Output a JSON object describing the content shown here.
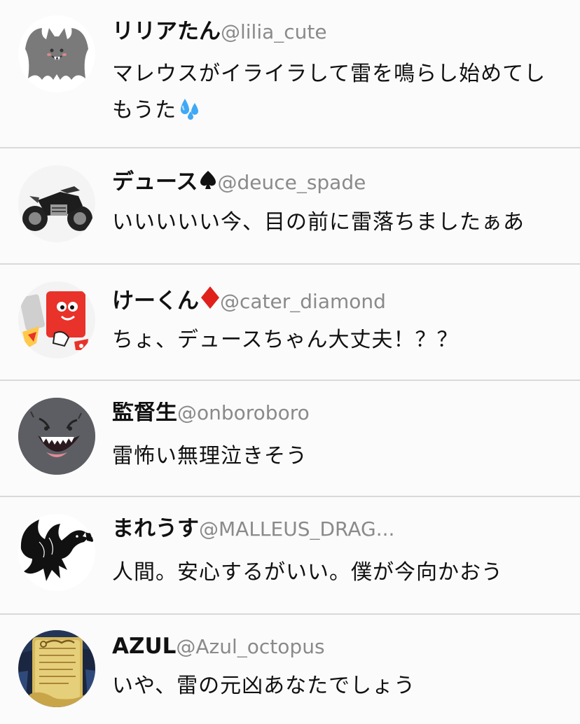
{
  "tweets": [
    {
      "display_name": "リリアたん",
      "handle": "@lilia_cute",
      "text": "マレウスがイライラして雷を鳴らし始めてしもうた",
      "avatar_icon": "bat-icon",
      "trailing_emoji": "sweat-droplets-emoji"
    },
    {
      "display_name": "デュース",
      "handle": "@deuce_spade",
      "text": "いいいいい今、目の前に雷落ちましたぁあ",
      "avatar_icon": "motorcycle-icon",
      "suit_icon": "spade-icon"
    },
    {
      "display_name": "けーくん",
      "handle": "@cater_diamond",
      "text": "ちょ、デュースちゃん大丈夫！？？",
      "avatar_icon": "red-phone-character-icon",
      "suit_icon": "diamond-icon"
    },
    {
      "display_name": "監督生",
      "handle": "@onboroboro",
      "text": "雷怖い無理泣きそう",
      "avatar_icon": "ghost-face-icon"
    },
    {
      "display_name": "まれうす",
      "handle": "@MALLEUS_DRAG...",
      "text": "人間。安心するがいい。僕が今向かおう",
      "avatar_icon": "dragon-silhouette-icon"
    },
    {
      "display_name": "AZUL",
      "handle": "@Azul_octopus",
      "text": "いや、雷の元凶あなたでしょう",
      "avatar_icon": "contract-scroll-icon"
    }
  ],
  "colors": {
    "background": "#fbfbfb",
    "divider": "#d9d9d9",
    "handle": "#8a8a8a",
    "text": "#111111",
    "diamond": "#e0211b"
  }
}
